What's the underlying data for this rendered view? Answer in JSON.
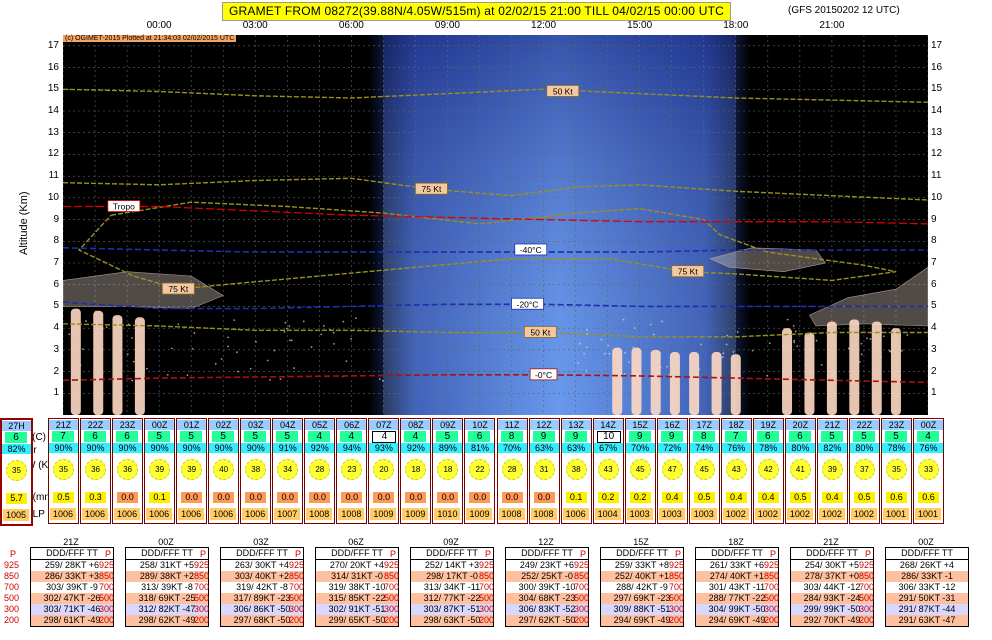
{
  "title": "GRAMET FROM 08272(39.88N/4.05W/515m) at 02/02/15 21:00   TILL  04/02/15 00:00 UTC",
  "subtitle": "(GFS 20150202 12 UTC)",
  "copyright": "(c) OGIMET-2015 Plotted at 21:34:03 02/02/2015 UTC",
  "y_axis_label": "Altitude (Km)",
  "chart_data": {
    "type": "area",
    "title": "GRAMET FROM 08272(39.88N/4.05W/515m) at 02/02/15 21:00   TILL  04/02/15 00:00 UTC",
    "xlabel": "",
    "ylabel": "Altitude (Km)",
    "x_ticks": [
      "00:00",
      "03:00",
      "06:00",
      "09:00",
      "12:00",
      "15:00",
      "18:00",
      "21:00"
    ],
    "y_ticks": [
      1,
      2,
      3,
      4,
      5,
      6,
      7,
      8,
      9,
      10,
      11,
      12,
      13,
      14,
      15,
      16,
      17
    ],
    "ylim": [
      0,
      17.5
    ],
    "xlim_hours": [
      -3,
      24
    ],
    "grid": true,
    "daylight_band_hours": [
      7,
      18
    ],
    "isotherms": [
      {
        "name": "-40°C",
        "x": [
          -3,
          0,
          3,
          6,
          9,
          12,
          15,
          18,
          21,
          24
        ],
        "y": [
          7.7,
          7.6,
          7.5,
          7.5,
          7.5,
          7.5,
          7.5,
          7.6,
          7.6,
          7.6
        ]
      },
      {
        "name": "-20°C",
        "x": [
          -3,
          0,
          3,
          6,
          9,
          12,
          15,
          18,
          21,
          24
        ],
        "y": [
          5.2,
          4.9,
          4.9,
          5.0,
          5.1,
          5.1,
          5.0,
          5.0,
          5.0,
          5.0
        ]
      },
      {
        "name": "-0°C",
        "x": [
          -3,
          0,
          3,
          6,
          9,
          12,
          15,
          18,
          21,
          24
        ],
        "y": [
          1.6,
          1.7,
          1.75,
          1.8,
          1.85,
          1.85,
          1.8,
          1.7,
          1.6,
          1.5
        ]
      }
    ],
    "tropopause": {
      "name": "Tropo",
      "x": [
        -3,
        0,
        3,
        6,
        9,
        12,
        15,
        18,
        21,
        24
      ],
      "y": [
        9.6,
        9.6,
        9.4,
        9.2,
        9.1,
        9.0,
        8.9,
        8.9,
        8.9,
        8.8
      ]
    },
    "wind_labels": [
      {
        "text": "50 Kt",
        "x": 12.6,
        "y": 14.9
      },
      {
        "text": "75 Kt",
        "x": 8.5,
        "y": 10.4
      },
      {
        "text": "75 Kt",
        "x": 16.5,
        "y": 6.6
      },
      {
        "text": "75 Kt",
        "x": 0.6,
        "y": 5.8
      },
      {
        "text": "50 Kt",
        "x": 11.9,
        "y": 3.8
      }
    ],
    "hours": [
      -3,
      -2,
      -1,
      0,
      1,
      2,
      3,
      4,
      5,
      6,
      7,
      8,
      9,
      10,
      11,
      12,
      13,
      14,
      15,
      16,
      17,
      18,
      19,
      20,
      21,
      22,
      23,
      24
    ]
  },
  "point_labels": [
    "21Z",
    "22Z",
    "23Z",
    "00Z",
    "01Z",
    "02Z",
    "03Z",
    "04Z",
    "05Z",
    "06Z",
    "07Z",
    "08Z",
    "09Z",
    "10Z",
    "11Z",
    "12Z",
    "13Z",
    "14Z",
    "15Z",
    "16Z",
    "17Z",
    "18Z",
    "19Z",
    "20Z",
    "21Z",
    "22Z",
    "23Z",
    "00Z",
    "27H"
  ],
  "row_labels": {
    "t": "T(C)",
    "hr": "Hr",
    "w": "W (Kmh",
    "p": "P(mm)",
    "slp": "SLP"
  },
  "temps": [
    "7",
    "6",
    "6",
    "5",
    "5",
    "5",
    "5",
    "5",
    "4",
    "4",
    "4",
    "4",
    "5",
    "6",
    "8",
    "9",
    "9",
    "10",
    "9",
    "9",
    "8",
    "7",
    "6",
    "6",
    "5",
    "5",
    "5",
    "4",
    "6"
  ],
  "boxed_temp_index": [
    10,
    17
  ],
  "humidity": [
    "90%",
    "90%",
    "90%",
    "90%",
    "90%",
    "90%",
    "90%",
    "91%",
    "92%",
    "94%",
    "93%",
    "92%",
    "89%",
    "81%",
    "70%",
    "63%",
    "63%",
    "67%",
    "70%",
    "72%",
    "74%",
    "76%",
    "78%",
    "80%",
    "82%",
    "80%",
    "78%",
    "76%",
    "82%"
  ],
  "wind": [
    "35",
    "36",
    "36",
    "39",
    "39",
    "40",
    "38",
    "34",
    "28",
    "23",
    "20",
    "18",
    "18",
    "22",
    "28",
    "31",
    "38",
    "43",
    "45",
    "47",
    "45",
    "43",
    "42",
    "41",
    "39",
    "37",
    "35",
    "33",
    "35"
  ],
  "precip": [
    "0.5",
    "0.3",
    "0.0",
    "0.1",
    "0.0",
    "0.0",
    "0.0",
    "0.0",
    "0.0",
    "0.0",
    "0.0",
    "0.0",
    "0.0",
    "0.0",
    "0.0",
    "0.0",
    "0.1",
    "0.2",
    "0.2",
    "0.4",
    "0.5",
    "0.4",
    "0.4",
    "0.5",
    "0.4",
    "0.5",
    "0.6",
    "0.6",
    "5.7"
  ],
  "slp": [
    "1006",
    "1006",
    "1006",
    "1006",
    "1006",
    "1006",
    "1006",
    "1007",
    "1008",
    "1008",
    "1009",
    "1009",
    "1010",
    "1009",
    "1008",
    "1008",
    "1006",
    "1004",
    "1003",
    "1003",
    "1003",
    "1002",
    "1002",
    "1002",
    "1002",
    "1002",
    "1001",
    "1001",
    "1005"
  ],
  "upper_winds": {
    "pressure_header": "P",
    "column_header": "DDD/FFF TT",
    "levels": [
      "925",
      "850",
      "700",
      "500",
      "300",
      "200"
    ],
    "blocks": [
      {
        "time": "21Z",
        "rows": [
          "259/ 28KT +6",
          "286/ 33KT +3",
          "303/ 39KT -9",
          "302/ 47KT -26",
          "303/ 71KT -46",
          "298/ 61KT -49"
        ]
      },
      {
        "time": "00Z",
        "rows": [
          "258/ 31KT +5",
          "289/ 38KT +2",
          "313/ 39KT -8",
          "318/ 69KT -25",
          "312/ 82KT -47",
          "298/ 62KT -49"
        ]
      },
      {
        "time": "03Z",
        "rows": [
          "263/ 30KT +4",
          "303/ 40KT +2",
          "319/ 42KT -8",
          "317/ 89KT -23",
          "306/ 86KT -50",
          "297/ 68KT -50"
        ]
      },
      {
        "time": "06Z",
        "rows": [
          "270/ 20KT +4",
          "314/ 31KT -0",
          "319/ 38KT -10",
          "315/ 85KT -22",
          "302/ 91KT -51",
          "299/ 65KT -50"
        ]
      },
      {
        "time": "09Z",
        "rows": [
          "252/ 14KT +3",
          "298/ 17KT -0",
          "313/ 34KT -11",
          "312/ 77KT -22",
          "303/ 87KT -51",
          "298/ 63KT -50"
        ]
      },
      {
        "time": "12Z",
        "rows": [
          "249/ 23KT +6",
          "252/ 25KT -0",
          "300/ 39KT -10",
          "304/ 68KT -23",
          "306/ 83KT -52",
          "297/ 62KT -50"
        ]
      },
      {
        "time": "15Z",
        "rows": [
          "259/ 33KT +8",
          "252/ 40KT +1",
          "288/ 42KT -9",
          "297/ 69KT -23",
          "309/ 88KT -51",
          "294/ 69KT -49"
        ]
      },
      {
        "time": "18Z",
        "rows": [
          "261/ 33KT +6",
          "274/ 40KT +1",
          "301/ 43KT -11",
          "288/ 77KT -22",
          "304/ 99KT -50",
          "294/ 69KT -49"
        ]
      },
      {
        "time": "21Z",
        "rows": [
          "254/ 30KT +5",
          "278/ 37KT +0",
          "303/ 44KT -12",
          "284/ 93KT -24",
          "299/ 99KT -50",
          "292/ 70KT -49"
        ]
      },
      {
        "time": "00Z",
        "rows": [
          "268/ 26KT +4",
          "286/ 33KT -1",
          "306/ 33KT -12",
          "291/ 50KT -31",
          "291/ 87KT -44",
          "291/ 63KT -47"
        ]
      }
    ]
  },
  "colors": {
    "title_bg": "#ffff00",
    "plot_bg": "#000000",
    "day_band": "#3c6cd8",
    "isotherm": "#1d2db4",
    "zero_iso": "#aa1111",
    "tropo": "#dd0000",
    "wind_contour": "#9a9020",
    "cloud": "#f3d0b0",
    "precip_col": "#ffd9c2",
    "t_bg": "#33ff99",
    "h_bg": "#33ffff",
    "hdr_bg": "#a5c9ff",
    "w_bg": "#ffff33",
    "p_bg": "#fff000",
    "p_zero": "#ff9955",
    "slp_bg": "#ffcc66",
    "alt_row": "#ffc0a0",
    "alt_row2": "#d8d8ff"
  }
}
